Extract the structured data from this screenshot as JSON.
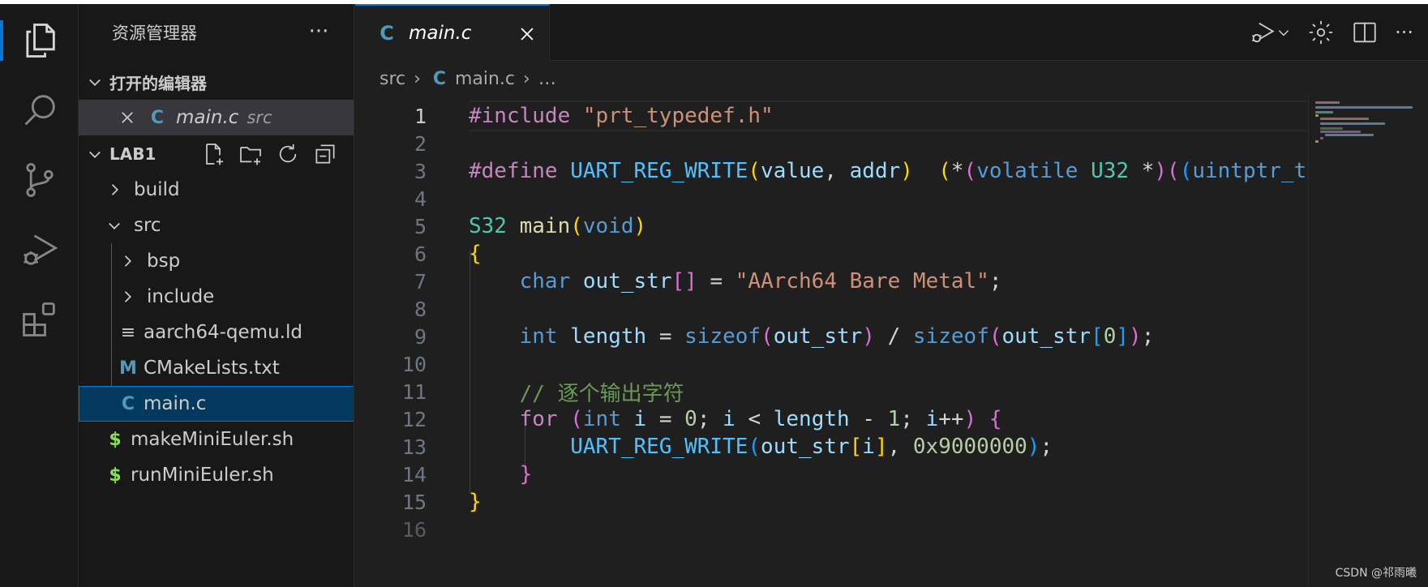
{
  "sidebar": {
    "title": "资源管理器",
    "more": "···",
    "open_editors": {
      "header": "打开的编辑器",
      "items": [
        {
          "icon": "C",
          "name": "main.c",
          "path": "src"
        }
      ]
    },
    "project": {
      "header": "LAB1",
      "actions": [
        "new-file-icon",
        "new-folder-icon",
        "refresh-icon",
        "collapse-all-icon"
      ],
      "tree": [
        {
          "name": "build",
          "type": "folder",
          "expanded": false
        },
        {
          "name": "src",
          "type": "folder",
          "expanded": true
        },
        {
          "name": "bsp",
          "type": "folder",
          "expanded": false
        },
        {
          "name": "include",
          "type": "folder",
          "expanded": false
        },
        {
          "name": "aarch64-qemu.ld",
          "type": "file",
          "icon": "≡"
        },
        {
          "name": "CMakeLists.txt",
          "type": "file",
          "icon": "M"
        },
        {
          "name": "main.c",
          "type": "file",
          "icon": "C",
          "selected": true
        },
        {
          "name": "makeMiniEuler.sh",
          "type": "file",
          "icon": "$"
        },
        {
          "name": "runMiniEuler.sh",
          "type": "file",
          "icon": "$"
        }
      ]
    }
  },
  "editor": {
    "tab": {
      "icon": "C",
      "label": "main.c"
    },
    "breadcrumb": {
      "folder": "src",
      "icon": "C",
      "file": "main.c",
      "more": "…"
    },
    "line_numbers": [
      "1",
      "2",
      "3",
      "4",
      "5",
      "6",
      "7",
      "8",
      "9",
      "10",
      "11",
      "12",
      "13",
      "14",
      "15",
      "16"
    ],
    "comment_text": "// 逐个输出字符"
  },
  "colors": {
    "accent": "#0078d4",
    "c_icon": "#519aba",
    "shell_icon": "#89e051"
  },
  "watermark": "CSDN @祁雨曦"
}
